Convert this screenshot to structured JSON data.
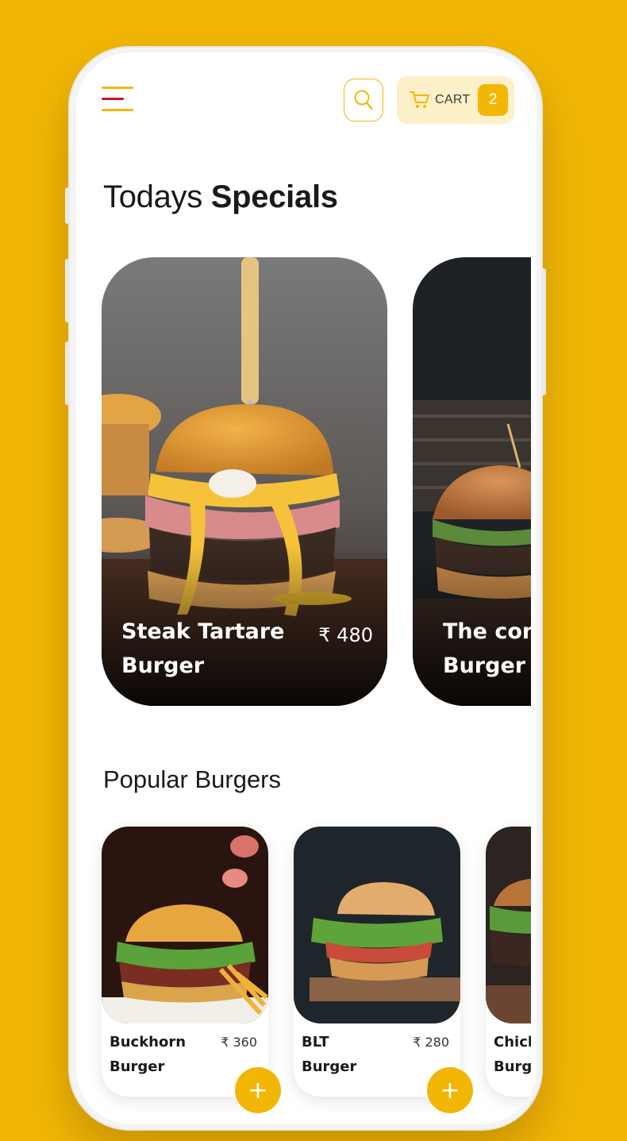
{
  "header": {
    "menu_icon": "hamburger-menu-icon",
    "search_icon": "search-icon",
    "cart_icon": "cart-icon",
    "cart_label": "CART",
    "cart_count": "2"
  },
  "specials": {
    "title_regular": "Todays",
    "title_bold": "Specials",
    "items": [
      {
        "name": "Steak Tartare\nBurger",
        "price": "₹ 480"
      },
      {
        "name": "The com\nBurger",
        "price": ""
      }
    ]
  },
  "popular": {
    "title": "Popular Burgers",
    "items": [
      {
        "name": "Buckhorn\nBurger",
        "price": "₹ 360"
      },
      {
        "name": "BLT\nBurger",
        "price": "₹ 280"
      },
      {
        "name": "Chick\nBurge",
        "price": ""
      }
    ],
    "add_label": "+"
  },
  "colors": {
    "accent": "#F2B705",
    "accent_soft": "#FDEFC7",
    "menu_red": "#C8102E"
  }
}
